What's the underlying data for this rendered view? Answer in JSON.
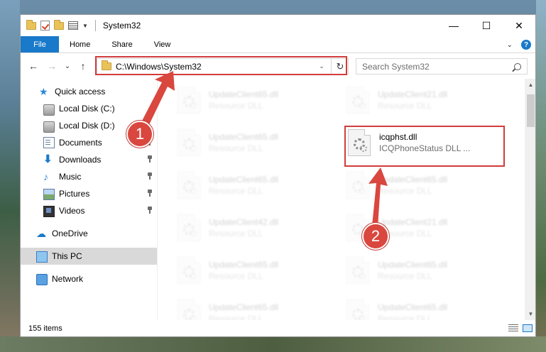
{
  "window": {
    "title": "System32",
    "controls": {
      "minimize": "—",
      "maximize": "☐",
      "close": "✕"
    }
  },
  "ribbon": {
    "tabs": [
      "File",
      "Home",
      "Share",
      "View"
    ],
    "help": "?",
    "accent": "#1979ca"
  },
  "nav": {
    "back": "←",
    "forward": "→",
    "recent": "⌄",
    "up": "↑",
    "address": "C:\\Windows\\System32",
    "refresh": "↻",
    "search_placeholder": "Search System32"
  },
  "sidebar": {
    "items": [
      {
        "label": "Quick access",
        "icon": "star-icon"
      },
      {
        "label": "Local Disk (C:)",
        "icon": "disk-icon"
      },
      {
        "label": "Local Disk (D:)",
        "icon": "disk-icon"
      },
      {
        "label": "Documents",
        "icon": "documents-icon",
        "pinned": true
      },
      {
        "label": "Downloads",
        "icon": "downloads-icon",
        "pinned": true
      },
      {
        "label": "Music",
        "icon": "music-icon",
        "pinned": true
      },
      {
        "label": "Pictures",
        "icon": "pictures-icon",
        "pinned": true
      },
      {
        "label": "Videos",
        "icon": "videos-icon",
        "pinned": true
      },
      {
        "label": "OneDrive",
        "icon": "onedrive-icon"
      },
      {
        "label": "This PC",
        "icon": "pc-icon",
        "selected": true
      },
      {
        "label": "Network",
        "icon": "network-icon"
      }
    ]
  },
  "files": [
    {
      "name": "UpdateClient65.dll",
      "type": "Resource DLL",
      "blurred": true
    },
    {
      "name": "UpdateClient21.dll",
      "type": "Resource DLL",
      "blurred": true
    },
    {
      "name": "UpdateClient65.dll",
      "type": "Resource DLL",
      "blurred": true
    },
    {
      "name": "icqphst.dll",
      "type": "ICQPhoneStatus DLL ...",
      "blurred": false
    },
    {
      "name": "UpdateClient65.dll",
      "type": "Resource DLL",
      "blurred": true
    },
    {
      "name": "UpdateClient65.dll",
      "type": "Resource DLL",
      "blurred": true
    },
    {
      "name": "UpdateClient42.dll",
      "type": "Resource DLL",
      "blurred": true
    },
    {
      "name": "UpdateClient21.dll",
      "type": "Resource DLL",
      "blurred": true
    },
    {
      "name": "UpdateClient65.dll",
      "type": "Resource DLL",
      "blurred": true
    },
    {
      "name": "UpdateClient65.dll",
      "type": "Resource DLL",
      "blurred": true
    },
    {
      "name": "UpdateClient65.dll",
      "type": "Resource DLL",
      "blurred": true
    },
    {
      "name": "UpdateClient65.dll",
      "type": "Resource DLL",
      "blurred": true
    }
  ],
  "status": {
    "item_count": "155 items"
  },
  "annotations": {
    "callout_1": "1",
    "callout_2": "2",
    "color": "#d9473f"
  }
}
